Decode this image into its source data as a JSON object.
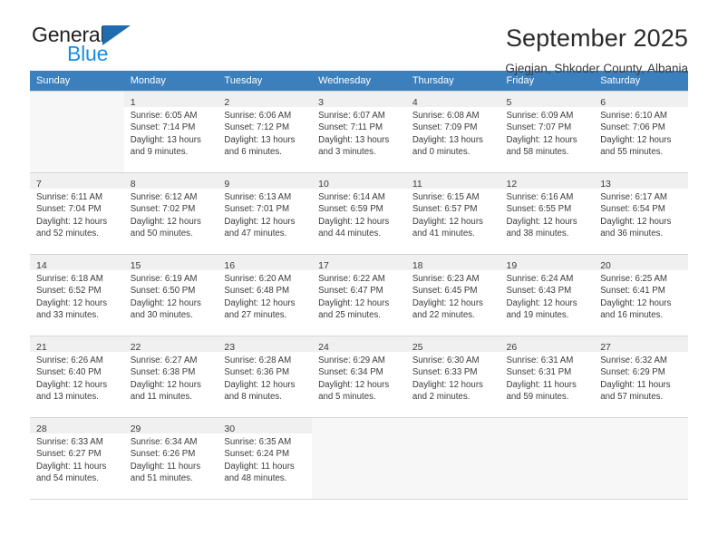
{
  "brand": {
    "line1": "General",
    "line2": "Blue",
    "triangle_color": "#1f6cb0",
    "blue_text_color": "#1a8fe0"
  },
  "header": {
    "title": "September 2025",
    "subtitle": "Gjegjan, Shkoder County, Albania"
  },
  "calendar": {
    "header_bg": "#3c7fbd",
    "weekdays": [
      "Sunday",
      "Monday",
      "Tuesday",
      "Wednesday",
      "Thursday",
      "Friday",
      "Saturday"
    ],
    "weeks": [
      [
        {
          "day": "",
          "lines": []
        },
        {
          "day": "1",
          "lines": [
            "Sunrise: 6:05 AM",
            "Sunset: 7:14 PM",
            "Daylight: 13 hours",
            "and 9 minutes."
          ]
        },
        {
          "day": "2",
          "lines": [
            "Sunrise: 6:06 AM",
            "Sunset: 7:12 PM",
            "Daylight: 13 hours",
            "and 6 minutes."
          ]
        },
        {
          "day": "3",
          "lines": [
            "Sunrise: 6:07 AM",
            "Sunset: 7:11 PM",
            "Daylight: 13 hours",
            "and 3 minutes."
          ]
        },
        {
          "day": "4",
          "lines": [
            "Sunrise: 6:08 AM",
            "Sunset: 7:09 PM",
            "Daylight: 13 hours",
            "and 0 minutes."
          ]
        },
        {
          "day": "5",
          "lines": [
            "Sunrise: 6:09 AM",
            "Sunset: 7:07 PM",
            "Daylight: 12 hours",
            "and 58 minutes."
          ]
        },
        {
          "day": "6",
          "lines": [
            "Sunrise: 6:10 AM",
            "Sunset: 7:06 PM",
            "Daylight: 12 hours",
            "and 55 minutes."
          ]
        }
      ],
      [
        {
          "day": "7",
          "lines": [
            "Sunrise: 6:11 AM",
            "Sunset: 7:04 PM",
            "Daylight: 12 hours",
            "and 52 minutes."
          ]
        },
        {
          "day": "8",
          "lines": [
            "Sunrise: 6:12 AM",
            "Sunset: 7:02 PM",
            "Daylight: 12 hours",
            "and 50 minutes."
          ]
        },
        {
          "day": "9",
          "lines": [
            "Sunrise: 6:13 AM",
            "Sunset: 7:01 PM",
            "Daylight: 12 hours",
            "and 47 minutes."
          ]
        },
        {
          "day": "10",
          "lines": [
            "Sunrise: 6:14 AM",
            "Sunset: 6:59 PM",
            "Daylight: 12 hours",
            "and 44 minutes."
          ]
        },
        {
          "day": "11",
          "lines": [
            "Sunrise: 6:15 AM",
            "Sunset: 6:57 PM",
            "Daylight: 12 hours",
            "and 41 minutes."
          ]
        },
        {
          "day": "12",
          "lines": [
            "Sunrise: 6:16 AM",
            "Sunset: 6:55 PM",
            "Daylight: 12 hours",
            "and 38 minutes."
          ]
        },
        {
          "day": "13",
          "lines": [
            "Sunrise: 6:17 AM",
            "Sunset: 6:54 PM",
            "Daylight: 12 hours",
            "and 36 minutes."
          ]
        }
      ],
      [
        {
          "day": "14",
          "lines": [
            "Sunrise: 6:18 AM",
            "Sunset: 6:52 PM",
            "Daylight: 12 hours",
            "and 33 minutes."
          ]
        },
        {
          "day": "15",
          "lines": [
            "Sunrise: 6:19 AM",
            "Sunset: 6:50 PM",
            "Daylight: 12 hours",
            "and 30 minutes."
          ]
        },
        {
          "day": "16",
          "lines": [
            "Sunrise: 6:20 AM",
            "Sunset: 6:48 PM",
            "Daylight: 12 hours",
            "and 27 minutes."
          ]
        },
        {
          "day": "17",
          "lines": [
            "Sunrise: 6:22 AM",
            "Sunset: 6:47 PM",
            "Daylight: 12 hours",
            "and 25 minutes."
          ]
        },
        {
          "day": "18",
          "lines": [
            "Sunrise: 6:23 AM",
            "Sunset: 6:45 PM",
            "Daylight: 12 hours",
            "and 22 minutes."
          ]
        },
        {
          "day": "19",
          "lines": [
            "Sunrise: 6:24 AM",
            "Sunset: 6:43 PM",
            "Daylight: 12 hours",
            "and 19 minutes."
          ]
        },
        {
          "day": "20",
          "lines": [
            "Sunrise: 6:25 AM",
            "Sunset: 6:41 PM",
            "Daylight: 12 hours",
            "and 16 minutes."
          ]
        }
      ],
      [
        {
          "day": "21",
          "lines": [
            "Sunrise: 6:26 AM",
            "Sunset: 6:40 PM",
            "Daylight: 12 hours",
            "and 13 minutes."
          ]
        },
        {
          "day": "22",
          "lines": [
            "Sunrise: 6:27 AM",
            "Sunset: 6:38 PM",
            "Daylight: 12 hours",
            "and 11 minutes."
          ]
        },
        {
          "day": "23",
          "lines": [
            "Sunrise: 6:28 AM",
            "Sunset: 6:36 PM",
            "Daylight: 12 hours",
            "and 8 minutes."
          ]
        },
        {
          "day": "24",
          "lines": [
            "Sunrise: 6:29 AM",
            "Sunset: 6:34 PM",
            "Daylight: 12 hours",
            "and 5 minutes."
          ]
        },
        {
          "day": "25",
          "lines": [
            "Sunrise: 6:30 AM",
            "Sunset: 6:33 PM",
            "Daylight: 12 hours",
            "and 2 minutes."
          ]
        },
        {
          "day": "26",
          "lines": [
            "Sunrise: 6:31 AM",
            "Sunset: 6:31 PM",
            "Daylight: 11 hours",
            "and 59 minutes."
          ]
        },
        {
          "day": "27",
          "lines": [
            "Sunrise: 6:32 AM",
            "Sunset: 6:29 PM",
            "Daylight: 11 hours",
            "and 57 minutes."
          ]
        }
      ],
      [
        {
          "day": "28",
          "lines": [
            "Sunrise: 6:33 AM",
            "Sunset: 6:27 PM",
            "Daylight: 11 hours",
            "and 54 minutes."
          ]
        },
        {
          "day": "29",
          "lines": [
            "Sunrise: 6:34 AM",
            "Sunset: 6:26 PM",
            "Daylight: 11 hours",
            "and 51 minutes."
          ]
        },
        {
          "day": "30",
          "lines": [
            "Sunrise: 6:35 AM",
            "Sunset: 6:24 PM",
            "Daylight: 11 hours",
            "and 48 minutes."
          ]
        },
        {
          "day": "",
          "lines": []
        },
        {
          "day": "",
          "lines": []
        },
        {
          "day": "",
          "lines": []
        },
        {
          "day": "",
          "lines": []
        }
      ]
    ]
  }
}
